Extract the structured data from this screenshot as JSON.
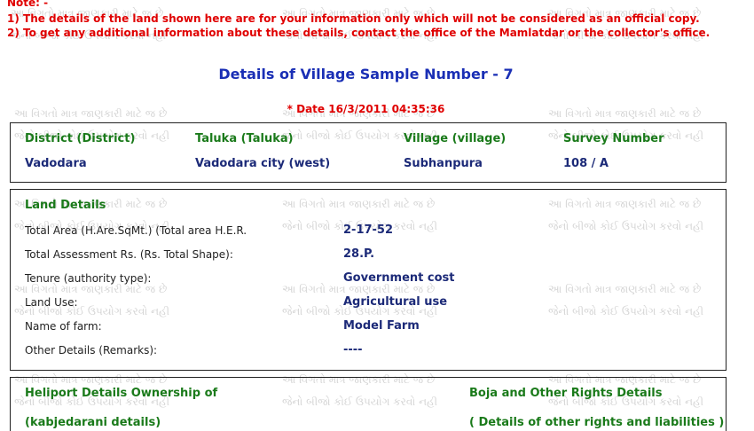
{
  "note": {
    "label": "Note: -",
    "line1": "1) The details of the land shown here are for your information only which will not be considered as an official copy.",
    "line2": "2) To get any additional information about these details, contact the office of the Mamlatdar or the collector's office."
  },
  "watermark": {
    "line1": "આ વિગતો માત્ર જાણકારી માટે જ છે",
    "line2": "જેનો બીજો કોઈ ઉપયોગ કરવો નહી"
  },
  "title": "Details of Village Sample Number - 7",
  "date": "* Date 16/3/2011 04:35:36",
  "location": {
    "district_label": "District (District)",
    "district_value": "Vadodara",
    "taluka_label": "Taluka (Taluka)",
    "taluka_value": "Vadodara city (west)",
    "village_label": "Village (village)",
    "village_value": "Subhanpura",
    "survey_label": "Survey Number",
    "survey_value": "108 / A"
  },
  "land": {
    "heading": "Land Details",
    "rows": [
      {
        "label": "Total Area (H.Are.SqMt.) (Total area H.E.R.",
        "value": "2-17-52"
      },
      {
        "label": "Total Assessment Rs. (Rs. Total Shape):",
        "value": "28.P."
      },
      {
        "label": "Tenure (authority type):",
        "value": "Government cost"
      },
      {
        "label": "Land Use:",
        "value": "Agricultural use"
      },
      {
        "label": "Name of farm:",
        "value": "Model Farm"
      },
      {
        "label": "Other Details (Remarks):",
        "value": "----"
      }
    ]
  },
  "ownership": {
    "heading_left_1": "Heliport Details Ownership of",
    "heading_left_2": "(kabjedarani details)",
    "heading_right_1": "Boja and Other Rights Details",
    "heading_right_2": "( Details of other rights and liabilities )"
  }
}
